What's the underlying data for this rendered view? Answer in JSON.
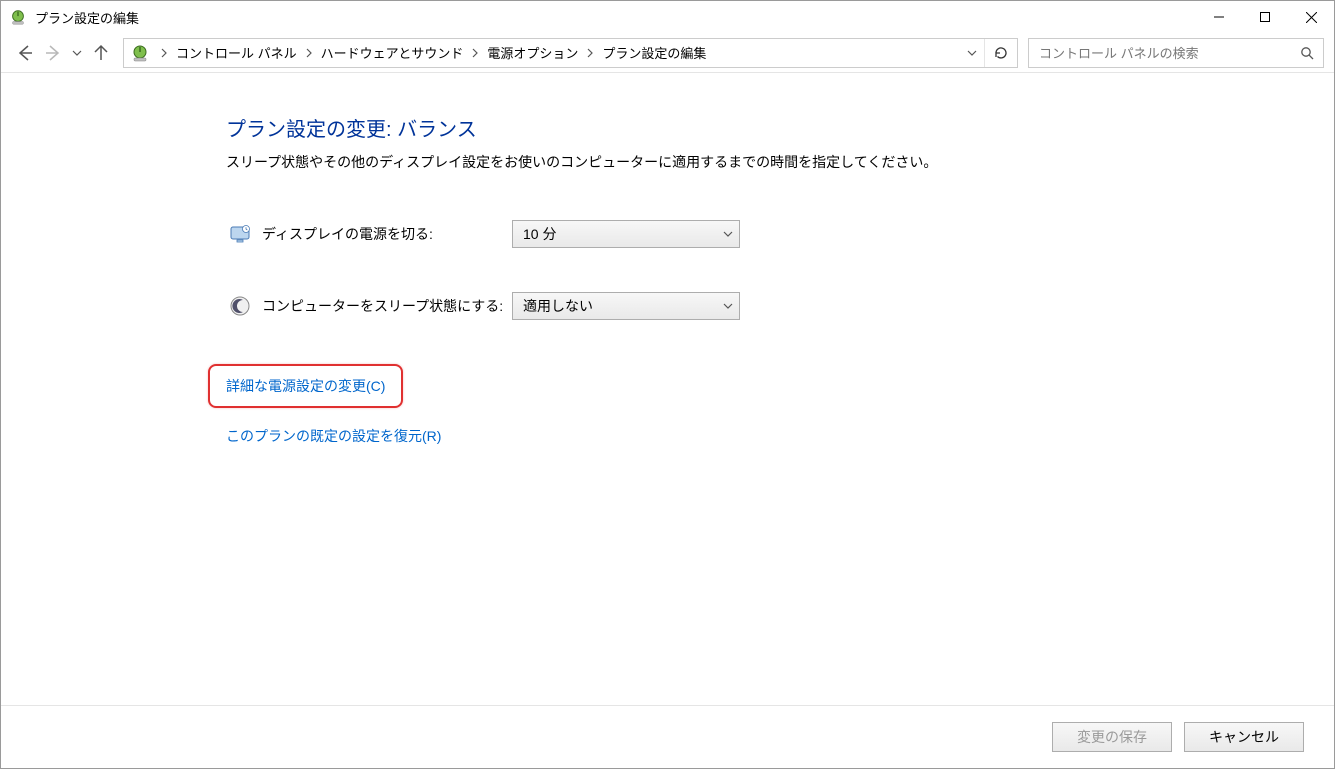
{
  "window": {
    "title": "プラン設定の編集"
  },
  "breadcrumb": {
    "items": [
      "コントロール パネル",
      "ハードウェアとサウンド",
      "電源オプション",
      "プラン設定の編集"
    ]
  },
  "search": {
    "placeholder": "コントロール パネルの検索"
  },
  "page": {
    "heading": "プラン設定の変更: バランス",
    "description": "スリープ状態やその他のディスプレイ設定をお使いのコンピューターに適用するまでの時間を指定してください。"
  },
  "settings": {
    "display_off": {
      "label": "ディスプレイの電源を切る:",
      "value": "10 分"
    },
    "sleep": {
      "label": "コンピューターをスリープ状態にする:",
      "value": "適用しない"
    }
  },
  "links": {
    "advanced": "詳細な電源設定の変更(C)",
    "restore": "このプランの既定の設定を復元(R)"
  },
  "buttons": {
    "save": "変更の保存",
    "cancel": "キャンセル"
  }
}
